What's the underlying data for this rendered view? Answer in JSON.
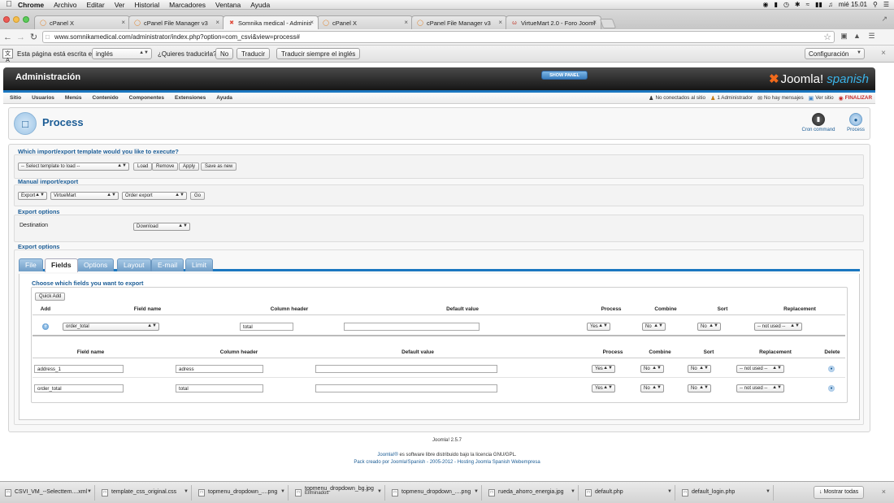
{
  "mac_menu": {
    "items": [
      "Chrome",
      "Archivo",
      "Editar",
      "Ver",
      "Historial",
      "Marcadores",
      "Ventana",
      "Ayuda"
    ],
    "clock": "mié 15.01"
  },
  "browser": {
    "tabs": [
      {
        "title": "cPanel X",
        "active": false
      },
      {
        "title": "cPanel File Manager v3",
        "active": false
      },
      {
        "title": "Somnika medical - Adminis",
        "active": true
      },
      {
        "title": "cPanel X",
        "active": false
      },
      {
        "title": "cPanel File Manager v3",
        "active": false
      },
      {
        "title": "VirtueMart 2.0 - Foro Jooml",
        "active": false
      }
    ],
    "url": "www.somnikamedical.com/administrator/index.php?option=com_csvi&view=process#"
  },
  "translate_bar": {
    "text": "Esta página está escrita en",
    "language": "inglés",
    "question": "¿Quieres traducirla?",
    "no": "No",
    "translate": "Traducir",
    "always": "Traducir siempre el inglés",
    "config": "Configuración"
  },
  "admin": {
    "title": "Administración",
    "show_panel": "SHOW PANEL",
    "logo_main": "Joomla!",
    "logo_sub": "spanish",
    "menu": [
      "Sitio",
      "Usuarios",
      "Menús",
      "Contenido",
      "Componentes",
      "Extensiones",
      "Ayuda"
    ],
    "status": {
      "visitors": "No conectados al sitio",
      "admins": "1 Administrador",
      "messages": "No hay mensajes",
      "view_site": "Ver sitio",
      "logout": "FINALIZAR"
    }
  },
  "toolbar": {
    "page_title": "Process",
    "cron": "Cron command",
    "process": "Process"
  },
  "template_section": {
    "legend": "Which import/export template would you like to execute?",
    "select": "-- Select template to load --",
    "load": "Load",
    "remove": "Remove",
    "apply": "Apply",
    "save_new": "Save as new"
  },
  "manual_section": {
    "legend": "Manual import/export",
    "action": "Export",
    "component": "VirtueMart",
    "operation": "Order export",
    "go": "Go"
  },
  "export_options1": {
    "legend": "Export options",
    "destination_label": "Destination",
    "destination_value": "Download"
  },
  "export_options2": {
    "legend": "Export options",
    "tabs": [
      "File",
      "Fields",
      "Options",
      "Layout",
      "E-mail",
      "Limit"
    ],
    "choose_legend": "Choose which fields you want to export",
    "quick_add": "Quick Add",
    "add_headers": [
      "Add",
      "Field name",
      "Column header",
      "Default value",
      "Process",
      "Combine",
      "Sort",
      "Replacement"
    ],
    "add_row": {
      "field": "order_total",
      "column": "total",
      "default": "",
      "process": "Yes",
      "combine": "No",
      "sort": "No",
      "replacement": "-- not used --"
    },
    "list_headers": [
      "Field name",
      "Column header",
      "Default value",
      "Process",
      "Combine",
      "Sort",
      "Replacement",
      "Delete"
    ],
    "rows": [
      {
        "field": "address_1",
        "column": "adress",
        "default": "",
        "process": "Yes",
        "combine": "No",
        "sort": "No",
        "replacement": "-- not used --"
      },
      {
        "field": "order_total",
        "column": "total",
        "default": "",
        "process": "Yes",
        "combine": "No",
        "sort": "No",
        "replacement": "-- not used --"
      }
    ]
  },
  "footer": {
    "version": "Joomla! 2.5.7",
    "license_link": "Joomla!®",
    "license_text": " es software libre distribuido bajo la licencia GNU/GPL.",
    "credit": "Pack creado por Joomla!Spanish - 2005-2012 - Hosting Joomla Spanish Webempresa"
  },
  "downloads": {
    "items": [
      {
        "name": "CSVI_VM_--Selecttem....xml",
        "sub": ""
      },
      {
        "name": "template_css_original.css",
        "sub": ""
      },
      {
        "name": "topmenu_dropdown_....png",
        "sub": ""
      },
      {
        "name": "topmenu_dropdown_bg.jpg",
        "sub": "Eliminados"
      },
      {
        "name": "topmenu_dropdown_....png",
        "sub": ""
      },
      {
        "name": "rueda_ahorro_energia.jpg",
        "sub": ""
      },
      {
        "name": "default.php",
        "sub": ""
      },
      {
        "name": "default_login.php",
        "sub": ""
      }
    ],
    "show_all": "Mostrar todas"
  }
}
